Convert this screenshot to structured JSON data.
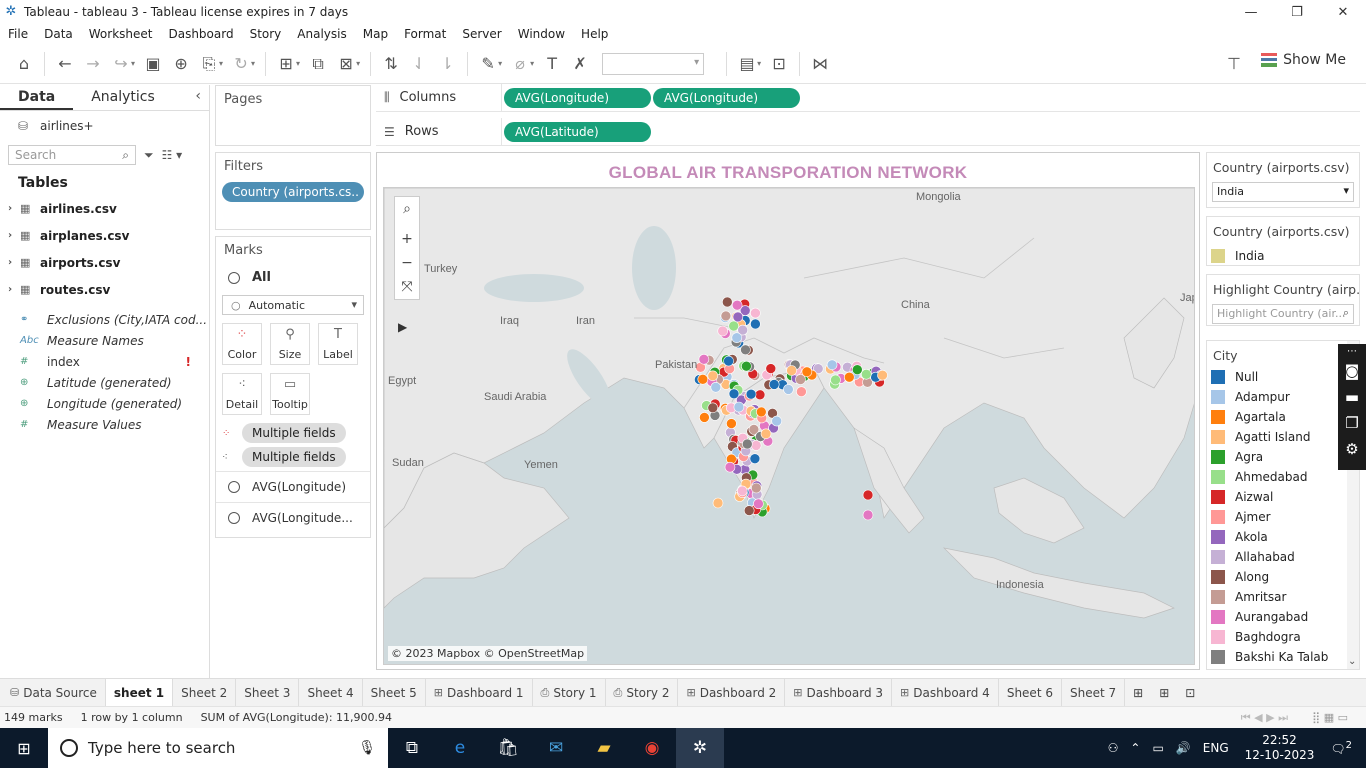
{
  "window": {
    "title": "Tableau - tableau 3 - Tableau license expires in 7 days"
  },
  "menu": [
    "File",
    "Data",
    "Worksheet",
    "Dashboard",
    "Story",
    "Analysis",
    "Map",
    "Format",
    "Server",
    "Window",
    "Help"
  ],
  "toolbar": {
    "show_me_label": "Show Me"
  },
  "data_pane": {
    "tab_data": "Data",
    "tab_analytics": "Analytics",
    "datasource": "airlines+",
    "search_placeholder": "Search",
    "tables_heading": "Tables",
    "tables": [
      "airlines.csv",
      "airplanes.csv",
      "airports.csv",
      "routes.csv"
    ],
    "fields": [
      {
        "type": "link",
        "name": "Exclusions (City,IATA cod...",
        "italic": true
      },
      {
        "type": "Abc",
        "name": "Measure Names",
        "italic": true
      },
      {
        "type": "#",
        "name": "index",
        "italic": false,
        "warning": "!"
      },
      {
        "type": "globe",
        "name": "Latitude (generated)",
        "italic": true
      },
      {
        "type": "globe",
        "name": "Longitude (generated)",
        "italic": true
      },
      {
        "type": "#",
        "name": "Measure Values",
        "italic": true
      }
    ]
  },
  "pages": {
    "heading": "Pages"
  },
  "filters": {
    "heading": "Filters",
    "items": [
      "Country (airports.cs.."
    ]
  },
  "marks": {
    "heading": "Marks",
    "all_label": "All",
    "mark_type": "Automatic",
    "buttons": [
      "Color",
      "Size",
      "Label",
      "Detail",
      "Tooltip"
    ],
    "multi_fields": [
      "Multiple fields",
      "Multiple fields"
    ],
    "layers": [
      "AVG(Longitude)",
      "AVG(Longitude..."
    ]
  },
  "shelves": {
    "columns_label": "Columns",
    "columns": [
      "AVG(Longitude)",
      "AVG(Longitude)"
    ],
    "rows_label": "Rows",
    "rows": [
      "AVG(Latitude)"
    ]
  },
  "view": {
    "title": "GLOBAL AIR TRANSPORATION NETWORK",
    "attribution": "© 2023 Mapbox © OpenStreetMap",
    "map_labels": [
      "Mongolia",
      "Turkey",
      "Iraq",
      "Iran",
      "China",
      "Pakistan",
      "Egypt",
      "Saudi Arabia",
      "Sudan",
      "Yemen",
      "Indonesia",
      "Jap"
    ]
  },
  "right_panel": {
    "filter_card_title": "Country (airports.csv)",
    "filter_value": "India",
    "color_card_title": "Country (airports.csv)",
    "color_item": "India",
    "color_item_hex": "#dcd48a",
    "highlight_title": "Highlight Country (airp...",
    "highlight_placeholder": "Highlight Country (air...",
    "city_title": "City",
    "cities": [
      {
        "name": "Null",
        "color": "#1f6fb4"
      },
      {
        "name": "Adampur",
        "color": "#a6c6e8"
      },
      {
        "name": "Agartala",
        "color": "#ff7f0e"
      },
      {
        "name": "Agatti Island",
        "color": "#ffbb78"
      },
      {
        "name": "Agra",
        "color": "#2ca02c"
      },
      {
        "name": "Ahmedabad",
        "color": "#98df8a"
      },
      {
        "name": "Aizwal",
        "color": "#d62728"
      },
      {
        "name": "Ajmer",
        "color": "#ff9896"
      },
      {
        "name": "Akola",
        "color": "#9467bd"
      },
      {
        "name": "Allahabad",
        "color": "#c5b0d5"
      },
      {
        "name": "Along",
        "color": "#8c564b"
      },
      {
        "name": "Amritsar",
        "color": "#c49c94"
      },
      {
        "name": "Aurangabad",
        "color": "#e377c2"
      },
      {
        "name": "Baghdogra",
        "color": "#f7b6d2"
      },
      {
        "name": "Bakshi Ka Talab",
        "color": "#7f7f7f"
      }
    ]
  },
  "sheet_tabs": [
    {
      "label": "Data Source",
      "icon": "datasource"
    },
    {
      "label": "sheet 1",
      "active": true
    },
    {
      "label": "Sheet 2"
    },
    {
      "label": "Sheet 3"
    },
    {
      "label": "Sheet 4"
    },
    {
      "label": "Sheet 5"
    },
    {
      "label": "Dashboard 1",
      "icon": "dashboard"
    },
    {
      "label": "Story 1",
      "icon": "story"
    },
    {
      "label": "Story 2",
      "icon": "story"
    },
    {
      "label": "Dashboard 2",
      "icon": "dashboard"
    },
    {
      "label": "Dashboard 3",
      "icon": "dashboard"
    },
    {
      "label": "Dashboard 4",
      "icon": "dashboard"
    },
    {
      "label": "Sheet 6"
    },
    {
      "label": "Sheet 7"
    }
  ],
  "status": {
    "marks": "149 marks",
    "rows_cols": "1 row by 1 column",
    "sum": "SUM of AVG(Longitude): 11,900.94"
  },
  "taskbar": {
    "search_placeholder": "Type here to search",
    "language": "ENG",
    "time": "22:52",
    "date": "12-10-2023",
    "notification_count": "2"
  }
}
